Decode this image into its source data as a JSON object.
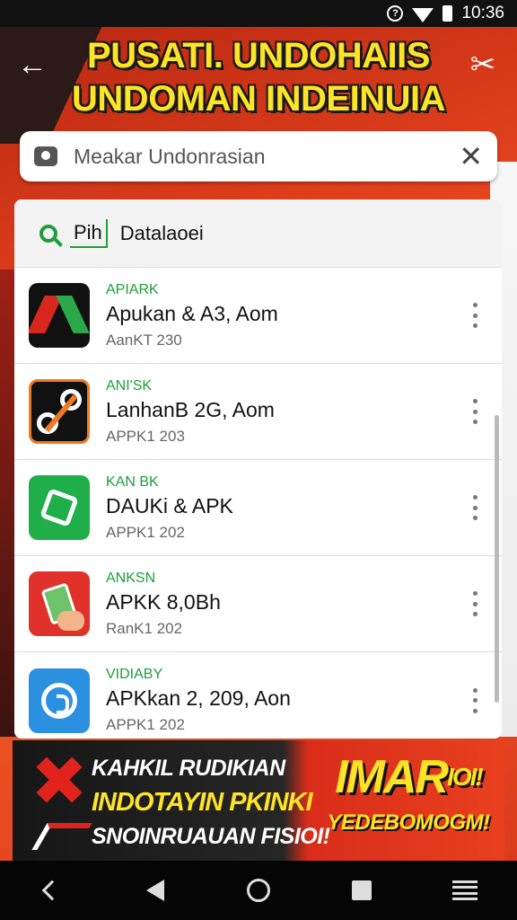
{
  "status_bar": {
    "time": "10:36",
    "alert_glyph": "?"
  },
  "header": {
    "back_glyph": "←",
    "title_line1": "PUSATI. UNDOHAIIS",
    "title_line2": "UNDOMAN INDEINUIA",
    "profile_glyph": "✂"
  },
  "search": {
    "placeholder": "Meakar Undonrasian",
    "value": "",
    "clear_glyph": "✕"
  },
  "filter": {
    "chip_label": "Pih",
    "label": "Datalaoei"
  },
  "apps": [
    {
      "tag": "APIARK",
      "name": "Apukan & A3, Aom",
      "meta": "AanKT 230",
      "icon": "triangle-app-icon"
    },
    {
      "tag": "ANI'SK",
      "name": "LanhanB 2G, Aom",
      "meta": "APPK1 203",
      "icon": "scissors-app-icon"
    },
    {
      "tag": "KAN BK",
      "name": "DAUKi & APK",
      "meta": "APPK1 202",
      "icon": "green-tent-app-icon"
    },
    {
      "tag": "ANKSN",
      "name": "APKK 8,0Bh",
      "meta": "RanK1 202",
      "icon": "phone-hand-app-icon"
    },
    {
      "tag": "VIDIABY",
      "name": "APKkan 2, 209, Aon",
      "meta": "APPK1 202",
      "icon": "chat-bubble-app-icon"
    }
  ],
  "banner": {
    "line1": "KAHKIL RUDIKIAN",
    "line2": "INDOTAYIN PKINKI",
    "line3": "SNOINRUAUAN FISIOI!",
    "right_big": "IMAR",
    "right_sup": "IOI!",
    "right_small": "YEDEBOMOGM!"
  },
  "colors": {
    "accent_red": "#d8361c",
    "title_yellow": "#ffe327",
    "tag_green": "#1e9e3a"
  }
}
